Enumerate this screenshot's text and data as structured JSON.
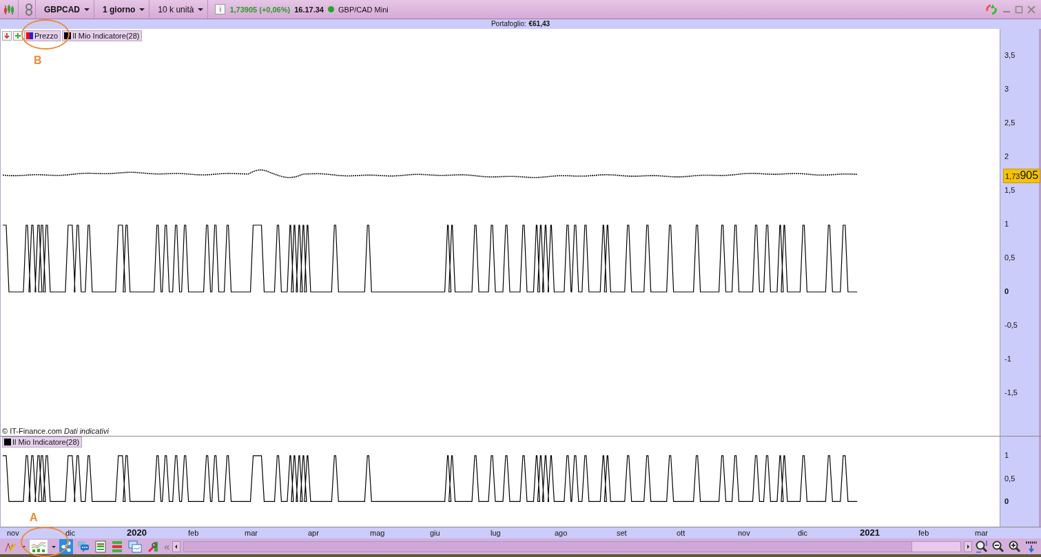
{
  "toolbar": {
    "symbol": "GBPCAD",
    "timeframe": "1 giorno",
    "size": "10 k unità",
    "info": "i",
    "quote": "1,73905 (+0,06%)",
    "time": "16.17.34",
    "market_open": true,
    "instrument": "GBP/CAD Mini"
  },
  "portfolio": {
    "label": "Portafoglio:",
    "value": "€61,43"
  },
  "main_pane": {
    "legend": [
      {
        "label": "Prezzo",
        "kind": "price"
      },
      {
        "label": "Il Mio Indicatore(28)",
        "kind": "indicator"
      }
    ],
    "y_ticks": [
      {
        "label": "3,5",
        "emphasized": false
      },
      {
        "label": "3",
        "emphasized": false
      },
      {
        "label": "2,5",
        "emphasized": false
      },
      {
        "label": "2",
        "emphasized": false
      },
      {
        "label": "1,5",
        "emphasized": false
      },
      {
        "label": "1",
        "emphasized": false
      },
      {
        "label": "0,5",
        "emphasized": false
      },
      {
        "label": "0",
        "emphasized": true
      },
      {
        "label": "-0,5",
        "emphasized": false
      },
      {
        "label": "-1",
        "emphasized": false
      },
      {
        "label": "-1,5",
        "emphasized": false
      }
    ],
    "price_badge": {
      "prefix": "1,73",
      "digits": "905"
    },
    "credit": "© IT-Finance.com *Dati indicativi*"
  },
  "lower_pane": {
    "legend": "Il Mio Indicatore(28)",
    "y_ticks": [
      {
        "label": "1",
        "emphasized": false
      },
      {
        "label": "0,5",
        "emphasized": false
      },
      {
        "label": "0",
        "emphasized": true
      }
    ]
  },
  "x_axis": [
    {
      "label": "nov",
      "emphasized": false
    },
    {
      "label": "dic",
      "emphasized": false
    },
    {
      "label": "2020",
      "emphasized": true
    },
    {
      "label": "feb",
      "emphasized": false
    },
    {
      "label": "mar",
      "emphasized": false
    },
    {
      "label": "apr",
      "emphasized": false
    },
    {
      "label": "mag",
      "emphasized": false
    },
    {
      "label": "giu",
      "emphasized": false
    },
    {
      "label": "lug",
      "emphasized": false
    },
    {
      "label": "ago",
      "emphasized": false
    },
    {
      "label": "set",
      "emphasized": false
    },
    {
      "label": "ott",
      "emphasized": false
    },
    {
      "label": "nov",
      "emphasized": false
    },
    {
      "label": "dic",
      "emphasized": false
    },
    {
      "label": "2021",
      "emphasized": true
    },
    {
      "label": "feb",
      "emphasized": false
    },
    {
      "label": "mar",
      "emphasized": false
    }
  ],
  "bottom_tools": [
    {
      "kind": "draw",
      "selected": false
    },
    {
      "kind": "indicators",
      "selected": true
    },
    {
      "kind": "share",
      "selected": false
    },
    {
      "kind": "comment",
      "selected": false
    },
    {
      "kind": "list",
      "selected": false
    },
    {
      "kind": "bricks",
      "selected": false
    },
    {
      "kind": "windows",
      "selected": false
    },
    {
      "kind": "wrench",
      "selected": false
    }
  ],
  "collapse": "«",
  "annotations": [
    {
      "label": "B"
    },
    {
      "label": "A"
    }
  ]
}
